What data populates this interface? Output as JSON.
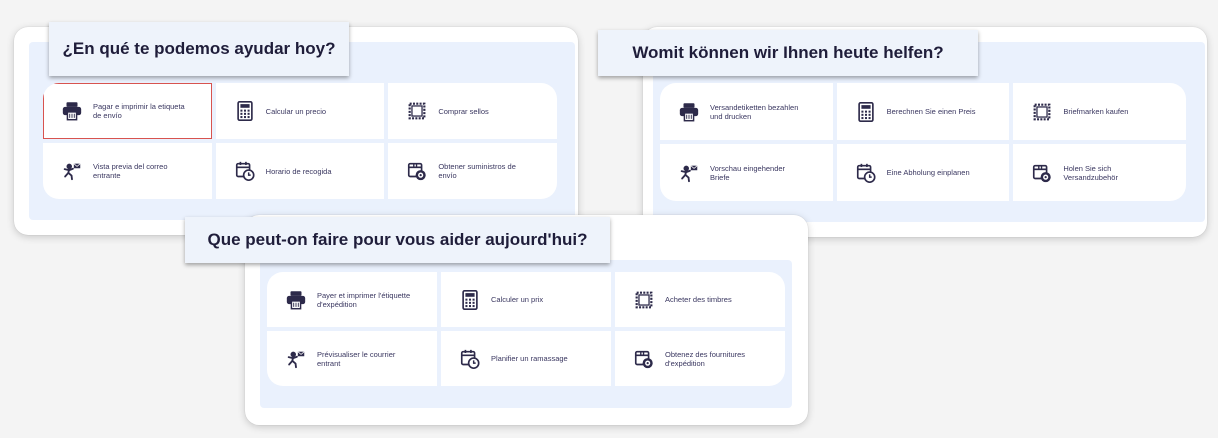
{
  "spanish": {
    "title": "¿En qué te podemos ayudar hoy?",
    "tiles": [
      {
        "label": "Pagar e imprimir la etiqueta de envío",
        "icon": "printer-icon",
        "selected": true
      },
      {
        "label": "Calcular un precio",
        "icon": "calculator-icon"
      },
      {
        "label": "Comprar sellos",
        "icon": "stamp-icon"
      },
      {
        "label": "Vista previa del correo entrante",
        "icon": "incoming-mail-icon"
      },
      {
        "label": "Horario de recogida",
        "icon": "pickup-schedule-icon"
      },
      {
        "label": "Obtener suministros de envío",
        "icon": "shipping-supplies-icon"
      }
    ]
  },
  "german": {
    "title": "Womit können wir Ihnen heute helfen?",
    "tiles": [
      {
        "label": "Versandetiketten bezahlen und drucken",
        "icon": "printer-icon"
      },
      {
        "label": "Berechnen Sie einen Preis",
        "icon": "calculator-icon"
      },
      {
        "label": "Briefmarken kaufen",
        "icon": "stamp-icon"
      },
      {
        "label": "Vorschau eingehender Briefe",
        "icon": "incoming-mail-icon"
      },
      {
        "label": "Eine Abholung einplanen",
        "icon": "pickup-schedule-icon"
      },
      {
        "label": "Holen Sie sich Versandzubehör",
        "icon": "shipping-supplies-icon"
      }
    ]
  },
  "french": {
    "title": "Que peut-on faire pour vous aider aujourd'hui?",
    "tiles": [
      {
        "label": "Payer et imprimer l'étiquette d'expédition",
        "icon": "printer-icon"
      },
      {
        "label": "Calculer un prix",
        "icon": "calculator-icon"
      },
      {
        "label": "Acheter des timbres",
        "icon": "stamp-icon"
      },
      {
        "label": "Prévisualiser le courrier entrant",
        "icon": "incoming-mail-icon"
      },
      {
        "label": "Planifier un ramassage",
        "icon": "pickup-schedule-icon"
      },
      {
        "label": "Obtenez des fournitures d'expédition",
        "icon": "shipping-supplies-icon"
      }
    ]
  },
  "colors": {
    "selected_border": "#d8534f",
    "panel_bg": "#eaf1fd",
    "icon": "#2d2a4a"
  }
}
